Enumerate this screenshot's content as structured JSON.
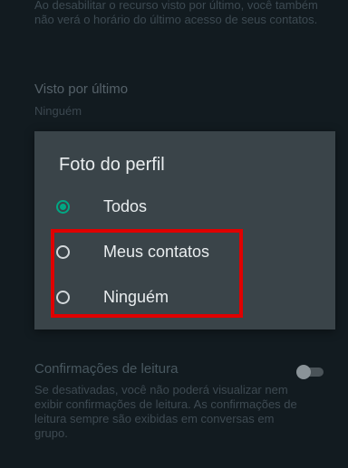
{
  "intro_text": "Ao desabilitar o recurso visto por último, você também não verá o horário do último acesso de seus contatos.",
  "last_seen": {
    "title": "Visto por último",
    "value": "Ninguém"
  },
  "dialog": {
    "title": "Foto do perfil",
    "options": [
      {
        "label": "Todos",
        "selected": true
      },
      {
        "label": "Meus contatos",
        "selected": false
      },
      {
        "label": "Ninguém",
        "selected": false
      }
    ]
  },
  "read_receipts": {
    "title": "Confirmações de leitura",
    "description": "Se desativadas, você não poderá visualizar nem exibir confirmações de leitura. As confirmações de leitura sempre são exibidas em conversas em grupo.",
    "enabled": false
  },
  "colors": {
    "accent": "#00a884",
    "highlight": "#e00000",
    "dialog_background": "#3a4449",
    "screen_background": "#121b20"
  }
}
